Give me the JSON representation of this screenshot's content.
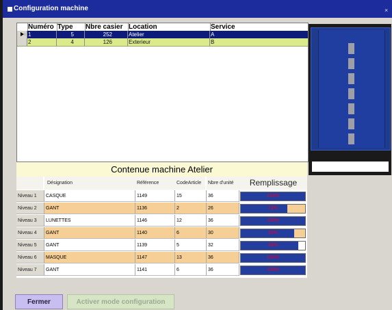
{
  "window": {
    "title": "Configuration machine",
    "close": "×"
  },
  "machines": {
    "columns": [
      "Numéro",
      "Type",
      "Nbre casier",
      "Location",
      "Service"
    ],
    "rows": [
      {
        "numero": "1",
        "type": "5",
        "casiers": "252",
        "location": "Atelier",
        "service": "A",
        "selected": true
      },
      {
        "numero": "2",
        "type": "4",
        "casiers": "126",
        "location": "Exterieur",
        "service": "B",
        "selected": false
      }
    ]
  },
  "content": {
    "title": "Contenue machine Atelier",
    "columns": {
      "designation": "Désignation",
      "reference": "Référence",
      "code": "CodeArticle",
      "units": "Nbre d'unité",
      "fill": "Remplissage"
    },
    "levels": [
      {
        "niveau": "Niveau 1",
        "designation": "CASQUE",
        "reference": "1149",
        "code": "15",
        "units": "36",
        "fill": 1.0,
        "fill_label": "100%",
        "highlight": false
      },
      {
        "niveau": "Niveau 2",
        "designation": "GANT",
        "reference": "1136",
        "code": "2",
        "units": "26",
        "fill": 0.72,
        "fill_label": "72%",
        "highlight": true
      },
      {
        "niveau": "Niveau 3",
        "designation": "LUNETTES",
        "reference": "1146",
        "code": "12",
        "units": "36",
        "fill": 1.0,
        "fill_label": "100%",
        "highlight": false
      },
      {
        "niveau": "Niveau 4",
        "designation": "GANT",
        "reference": "1140",
        "code": "6",
        "units": "30",
        "fill": 0.83,
        "fill_label": "83%",
        "highlight": true
      },
      {
        "niveau": "Niveau 5",
        "designation": "GANT",
        "reference": "1139",
        "code": "5",
        "units": "32",
        "fill": 0.89,
        "fill_label": "89%",
        "highlight": false
      },
      {
        "niveau": "Niveau 6",
        "designation": "MASQUE",
        "reference": "1147",
        "code": "13",
        "units": "36",
        "fill": 1.0,
        "fill_label": "100%",
        "highlight": true
      },
      {
        "niveau": "Niveau 7",
        "designation": "GANT",
        "reference": "1141",
        "code": "6",
        "units": "36",
        "fill": 1.0,
        "fill_label": "100%",
        "highlight": false
      }
    ]
  },
  "buttons": {
    "close": "Fermer",
    "config": "Activer mode configuration"
  },
  "colors": {
    "title_bar": "#1d2c9c",
    "selected_row": "#0d1b7a",
    "second_row": "#dbeb8c",
    "highlight_row": "#f6cf97",
    "fill_bar": "#233e9e",
    "fill_bar_partial": "#f6cf97",
    "pct_text": "#b0124c"
  }
}
